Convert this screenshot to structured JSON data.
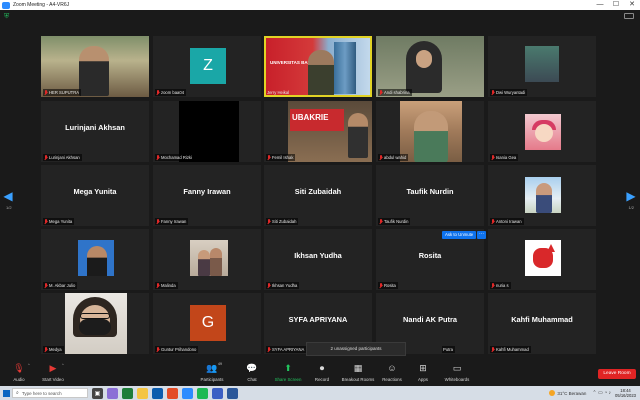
{
  "window": {
    "title": "Zoom Meeting - A4-VR6J",
    "minimize": "—",
    "maximize": "☐",
    "close": "✕"
  },
  "pagination": {
    "left": "1/2",
    "right": "1/2"
  },
  "tiles": [
    {
      "id": "t0",
      "label": "HER  SUPUTRA",
      "center_name": "",
      "avatar_letter": "",
      "active": false
    },
    {
      "id": "t1",
      "label": "zoom baa04",
      "center_name": "",
      "avatar_letter": "Z",
      "active": false
    },
    {
      "id": "t2",
      "label": "Jerry Heikal",
      "center_name": "",
      "avatar_letter": "",
      "active": true
    },
    {
      "id": "t3",
      "label": "Andi shabrina",
      "center_name": "",
      "avatar_letter": "",
      "active": false
    },
    {
      "id": "t4",
      "label": "Dwi Wuryantadi",
      "center_name": "",
      "avatar_letter": "",
      "active": false
    },
    {
      "id": "t5",
      "label": "Lurinjani Akhsan",
      "center_name": "Lurinjani Akhsan",
      "avatar_letter": "",
      "active": false
    },
    {
      "id": "t6",
      "label": "Mochamad Rizki",
      "center_name": "",
      "avatar_letter": "",
      "active": false
    },
    {
      "id": "t7",
      "label": "Femil Ishak",
      "center_name": "",
      "avatar_letter": "",
      "active": false
    },
    {
      "id": "t8",
      "label": "abdul wahid",
      "center_name": "",
      "avatar_letter": "",
      "active": false
    },
    {
      "id": "t9",
      "label": "Isania Gea",
      "center_name": "",
      "avatar_letter": "",
      "active": false
    },
    {
      "id": "t10",
      "label": "Mega Yunita",
      "center_name": "Mega Yunita",
      "avatar_letter": "",
      "active": false
    },
    {
      "id": "t11",
      "label": "Fanny Irawan",
      "center_name": "Fanny Irawan",
      "avatar_letter": "",
      "active": false
    },
    {
      "id": "t12",
      "label": "Siti Zubaidah",
      "center_name": "Siti Zubaidah",
      "avatar_letter": "",
      "active": false
    },
    {
      "id": "t13",
      "label": "Taufik Nurdin",
      "center_name": "Taufik Nurdin",
      "avatar_letter": "",
      "active": false
    },
    {
      "id": "t14",
      "label": "Antoni Irawan",
      "center_name": "",
      "avatar_letter": "",
      "active": false
    },
    {
      "id": "t15",
      "label": "M. Akbar Julio",
      "center_name": "",
      "avatar_letter": "",
      "active": false
    },
    {
      "id": "t16",
      "label": "Malinda",
      "center_name": "",
      "avatar_letter": "",
      "active": false
    },
    {
      "id": "t17",
      "label": "Ikhsan Yudha",
      "center_name": "Ikhsan Yudha",
      "avatar_letter": "",
      "active": false
    },
    {
      "id": "t18",
      "label": "Rosita",
      "center_name": "Rosita",
      "avatar_letter": "",
      "active": false
    },
    {
      "id": "t19",
      "label": "nuria s",
      "center_name": "",
      "avatar_letter": "",
      "active": false
    },
    {
      "id": "t20",
      "label": "Medya",
      "center_name": "",
      "avatar_letter": "",
      "active": false
    },
    {
      "id": "t21",
      "label": "Guntur Prihandono",
      "center_name": "",
      "avatar_letter": "G",
      "active": false
    },
    {
      "id": "t22",
      "label": "SYFA APRIYANA",
      "center_name": "SYFA APRIYANA",
      "avatar_letter": "",
      "active": false
    },
    {
      "id": "t23",
      "label": "Putra",
      "center_name": "Nandi AK Putra",
      "avatar_letter": "",
      "active": false
    },
    {
      "id": "t24",
      "label": "Kahfi Muhammad",
      "center_name": "Kahfi Muhammad",
      "avatar_letter": "",
      "active": false
    }
  ],
  "overlays": {
    "ask_to_unmute": "Ask to Unmute",
    "more": "···",
    "unassigned": "2 unassigned participants",
    "univ_text": "UNIVERSITAS BAKRIE",
    "banner_text": "UBAKRIE"
  },
  "toolbar": {
    "audio": "Audio",
    "start_video": "Start Video",
    "participants": "Participants",
    "participants_count": "49",
    "chat": "Chat",
    "share_screen": "Share Screen",
    "record": "Record",
    "breakout_rooms": "Breakout Rooms",
    "reactions": "Reactions",
    "apps": "Apps",
    "whiteboards": "Whiteboards",
    "leave_room": "Leave Room"
  },
  "taskbar": {
    "search_placeholder": "Type here to search",
    "weather": "31°C  Berawan",
    "time": "18:44",
    "date": "05/16/2023"
  },
  "colors": {
    "accent": "#2d8cff",
    "active_speaker": "#e1d325",
    "muted": "#e02828",
    "leave": "#e02424",
    "share": "#22c55e",
    "avatar_z": "#1aa7a7",
    "avatar_g": "#c2461a"
  }
}
